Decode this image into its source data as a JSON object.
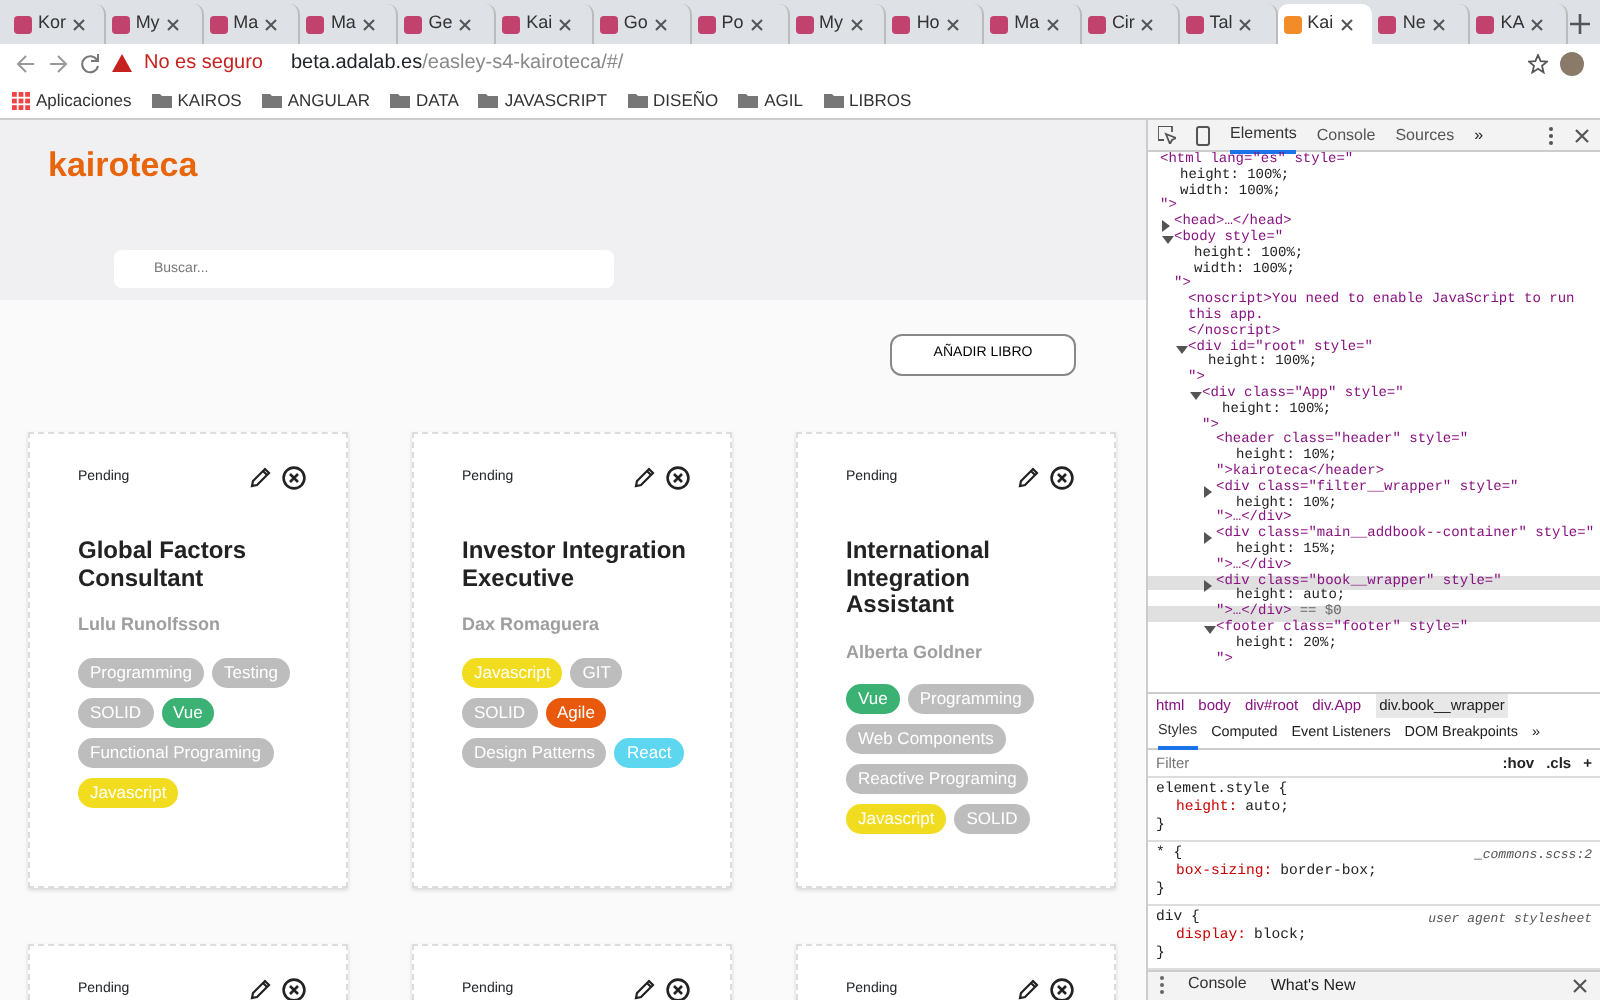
{
  "browser": {
    "tabs": [
      {
        "label": "Kor",
        "selected": false
      },
      {
        "label": "My",
        "selected": false
      },
      {
        "label": "Ma",
        "selected": false
      },
      {
        "label": "Ma",
        "selected": false
      },
      {
        "label": "Ge",
        "selected": false
      },
      {
        "label": "Kai",
        "selected": false
      },
      {
        "label": "Go",
        "selected": false
      },
      {
        "label": "Po",
        "selected": false
      },
      {
        "label": "My",
        "selected": false
      },
      {
        "label": "Ho",
        "selected": false
      },
      {
        "label": "Ma",
        "selected": false
      },
      {
        "label": "Cir",
        "selected": false
      },
      {
        "label": "Tal",
        "selected": false
      },
      {
        "label": "Kai",
        "selected": true
      },
      {
        "label": "Ne",
        "selected": false
      },
      {
        "label": "KA",
        "selected": false
      }
    ],
    "address": {
      "security": "No es seguro",
      "host": "beta.adalab.es",
      "path": "/easley-s4-kairoteca/#/"
    },
    "bookmarks": {
      "apps": "Aplicaciones",
      "folders": [
        "KAIROS",
        "ANGULAR",
        "DATA",
        "JAVASCRIPT",
        "DISEÑO",
        "AGIL",
        "LIBROS"
      ]
    }
  },
  "page": {
    "logo": "kairoteca",
    "search": {
      "placeholder": "Buscar..."
    },
    "add_button": "AÑADIR LIBRO",
    "books": [
      {
        "status": "Pending",
        "title": "Global Factors Consultant",
        "author": "Lulu Runolfsson",
        "tags": [
          {
            "label": "Programming",
            "color": "#bdbdbd"
          },
          {
            "label": "Testing",
            "color": "#bdbdbd"
          },
          {
            "label": "SOLID",
            "color": "#bdbdbd"
          },
          {
            "label": "Vue",
            "color": "#3bb273"
          },
          {
            "label": "Functional Programing",
            "color": "#bdbdbd"
          },
          {
            "label": "Javascript",
            "color": "#f2dc1f"
          }
        ]
      },
      {
        "status": "Pending",
        "title": "Investor Integration Executive",
        "author": "Dax Romaguera",
        "tags": [
          {
            "label": "Javascript",
            "color": "#f2dc1f"
          },
          {
            "label": "GIT",
            "color": "#bdbdbd"
          },
          {
            "label": "SOLID",
            "color": "#bdbdbd"
          },
          {
            "label": "Agile",
            "color": "#e8590c"
          },
          {
            "label": "Design Patterns",
            "color": "#bdbdbd"
          },
          {
            "label": "React",
            "color": "#5dd6f0"
          }
        ]
      },
      {
        "status": "Pending",
        "title": "International Integration Assistant",
        "author": "Alberta Goldner",
        "tags": [
          {
            "label": "Vue",
            "color": "#3bb273"
          },
          {
            "label": "Programming",
            "color": "#bdbdbd"
          },
          {
            "label": "Web Components",
            "color": "#bdbdbd"
          },
          {
            "label": "Reactive Programing",
            "color": "#bdbdbd"
          },
          {
            "label": "Javascript",
            "color": "#f2dc1f"
          },
          {
            "label": "SOLID",
            "color": "#bdbdbd"
          }
        ]
      },
      {
        "status": "Pending"
      },
      {
        "status": "Pending"
      },
      {
        "status": "Pending"
      }
    ]
  },
  "devtools": {
    "tabs": [
      {
        "label": "Elements",
        "selected": true
      },
      {
        "label": "Console",
        "selected": false
      },
      {
        "label": "Sources",
        "selected": false
      }
    ],
    "more": "»",
    "elements": [
      {
        "open": "<html lang=\"es\" style=\"",
        "style": [
          "height: 100%;",
          "width: 100%;"
        ],
        "close": "\">",
        "selected": false,
        "children": [
          {
            "open": "<head>…</head>",
            "expanded": false,
            "selected": false
          },
          {
            "open": "<body style=\"",
            "style": [
              "height: 100%;",
              "width: 100%;"
            ],
            "close": "\">",
            "expanded": true,
            "selected": false,
            "children": [
              {
                "open": "<noscript>You need to enable JavaScript to run this app.",
                "close": "</noscript>",
                "selected": false
              },
              {
                "open": "<div id=\"root\" style=\"",
                "style": [
                  "height: 100%;"
                ],
                "close": "\">",
                "expanded": true,
                "selected": false,
                "children": [
                  {
                    "open": "<div class=\"App\" style=\"",
                    "style": [
                      "height: 100%;"
                    ],
                    "close": "\">",
                    "expanded": true,
                    "selected": false,
                    "children": [
                      {
                        "open": "<header class=\"header\" style=\"",
                        "style": [
                          "height: 10%;"
                        ],
                        "close": "\">kairoteca</header>",
                        "selected": false
                      },
                      {
                        "open": "<div class=\"filter__wrapper\" style=\"",
                        "style": [
                          "height: 10%;"
                        ],
                        "close": "\">…</div>",
                        "expanded": false,
                        "selected": false
                      },
                      {
                        "open": "<div class=\"main__addbook--container\" style=\"",
                        "style": [
                          "height: 15%;"
                        ],
                        "close": "\">…</div>",
                        "expanded": false,
                        "selected": false
                      },
                      {
                        "open": "<div class=\"book__wrapper\" style=\"",
                        "style": [
                          "height: auto;"
                        ],
                        "close": "\">…</div>",
                        "suffix": "== $0",
                        "expanded": false,
                        "selected": true
                      },
                      {
                        "open": "<footer class=\"footer\" style=\"",
                        "style": [
                          "height: 20%;"
                        ],
                        "close": "\">",
                        "expanded": true,
                        "selected": false
                      }
                    ]
                  }
                ]
              }
            ]
          }
        ]
      }
    ],
    "breadcrumbs": [
      {
        "label": "html",
        "selected": false
      },
      {
        "label": "body",
        "selected": false
      },
      {
        "label": "div#root",
        "selected": false
      },
      {
        "label": "div.App",
        "selected": false
      },
      {
        "label": "div.book__wrapper",
        "selected": true
      }
    ],
    "styles_tabs": [
      {
        "label": "Styles",
        "selected": true
      },
      {
        "label": "Computed",
        "selected": false
      },
      {
        "label": "Event Listeners",
        "selected": false
      },
      {
        "label": "DOM Breakpoints",
        "selected": false
      }
    ],
    "styles_more": "»",
    "filter": {
      "placeholder": "Filter"
    },
    "filter_buttons": [
      ":hov",
      ".cls",
      "+"
    ],
    "rules": [
      {
        "selector": "element.style {",
        "declarations": [
          {
            "property": "height:",
            "value": "auto;"
          }
        ],
        "close": "}"
      },
      {
        "selector": "* {",
        "source": "_commons.scss:2",
        "declarations": [
          {
            "property": "box-sizing:",
            "value": "border-box;"
          }
        ],
        "close": "}"
      },
      {
        "selector": "div {",
        "source": "user agent stylesheet",
        "declarations": [
          {
            "property": "display:",
            "value": "block;"
          }
        ],
        "close": "}"
      }
    ],
    "drawer_tabs": [
      {
        "label": "Console",
        "selected": true
      },
      {
        "label": "What's New",
        "selected": false
      }
    ]
  }
}
